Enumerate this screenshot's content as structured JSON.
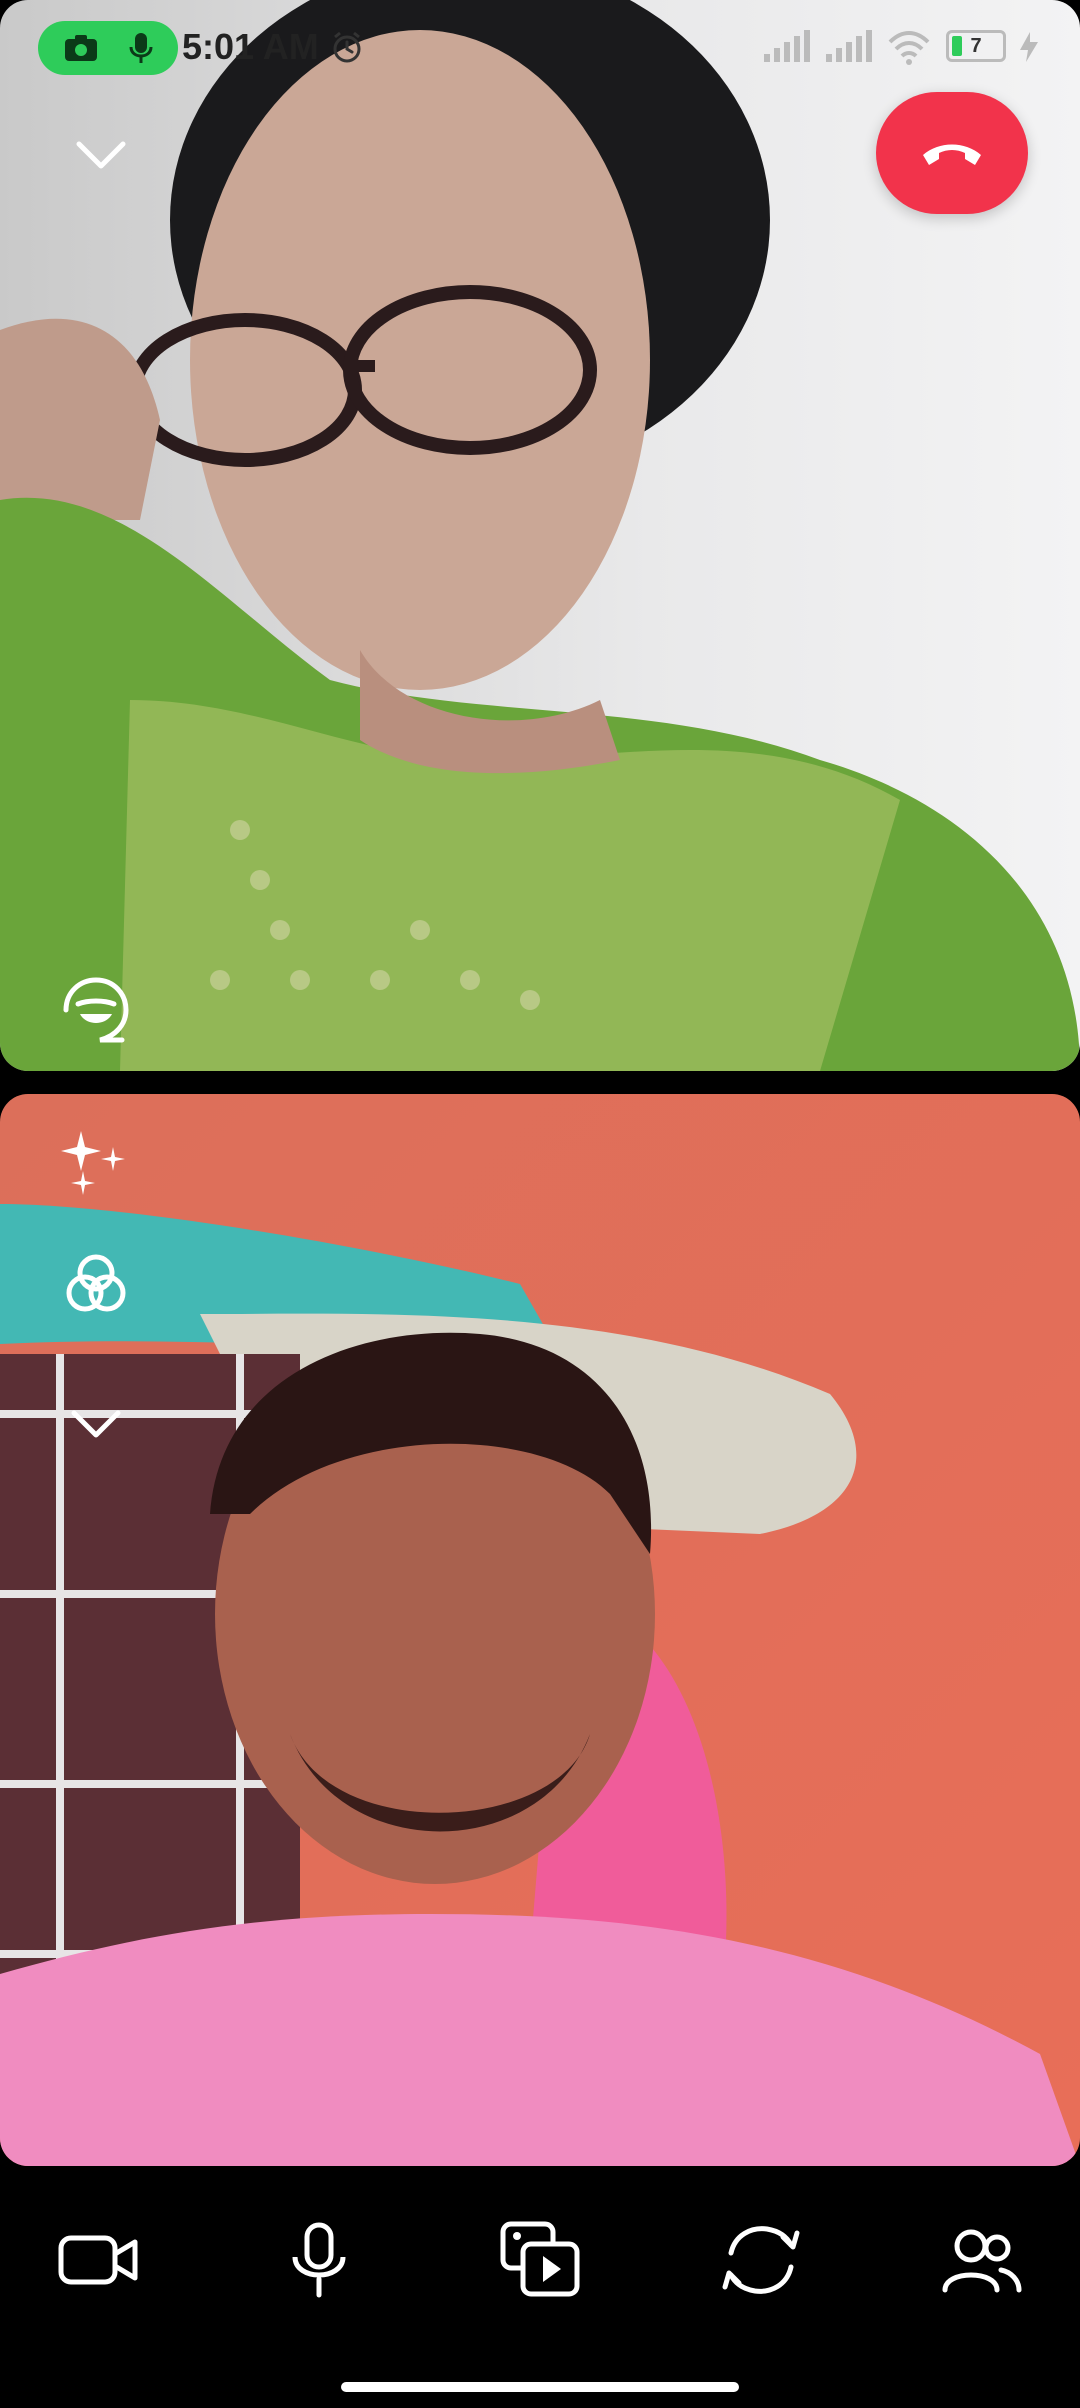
{
  "status_bar": {
    "time": "5:01 AM",
    "battery": "7",
    "indicator_colors": {
      "pill": "#2ecc5a"
    }
  },
  "colors": {
    "end_call": "#f2334b",
    "bar_background": "#000000",
    "icon": "#ffffff"
  },
  "top_tile": {
    "icons": [
      "chevron-down-icon",
      "end-call-icon",
      "sticker-icon"
    ]
  },
  "bottom_tile": {
    "icons": [
      "effects-sparkle-icon",
      "filters-circles-icon",
      "chevron-down-icon"
    ]
  },
  "bottom_bar": {
    "buttons": [
      {
        "name": "video-toggle-button",
        "icon": "video-camera-icon"
      },
      {
        "name": "mic-toggle-button",
        "icon": "microphone-icon"
      },
      {
        "name": "media-share-button",
        "icon": "media-play-icon"
      },
      {
        "name": "flip-camera-button",
        "icon": "rotate-camera-icon"
      },
      {
        "name": "participants-button",
        "icon": "people-icon"
      }
    ]
  }
}
